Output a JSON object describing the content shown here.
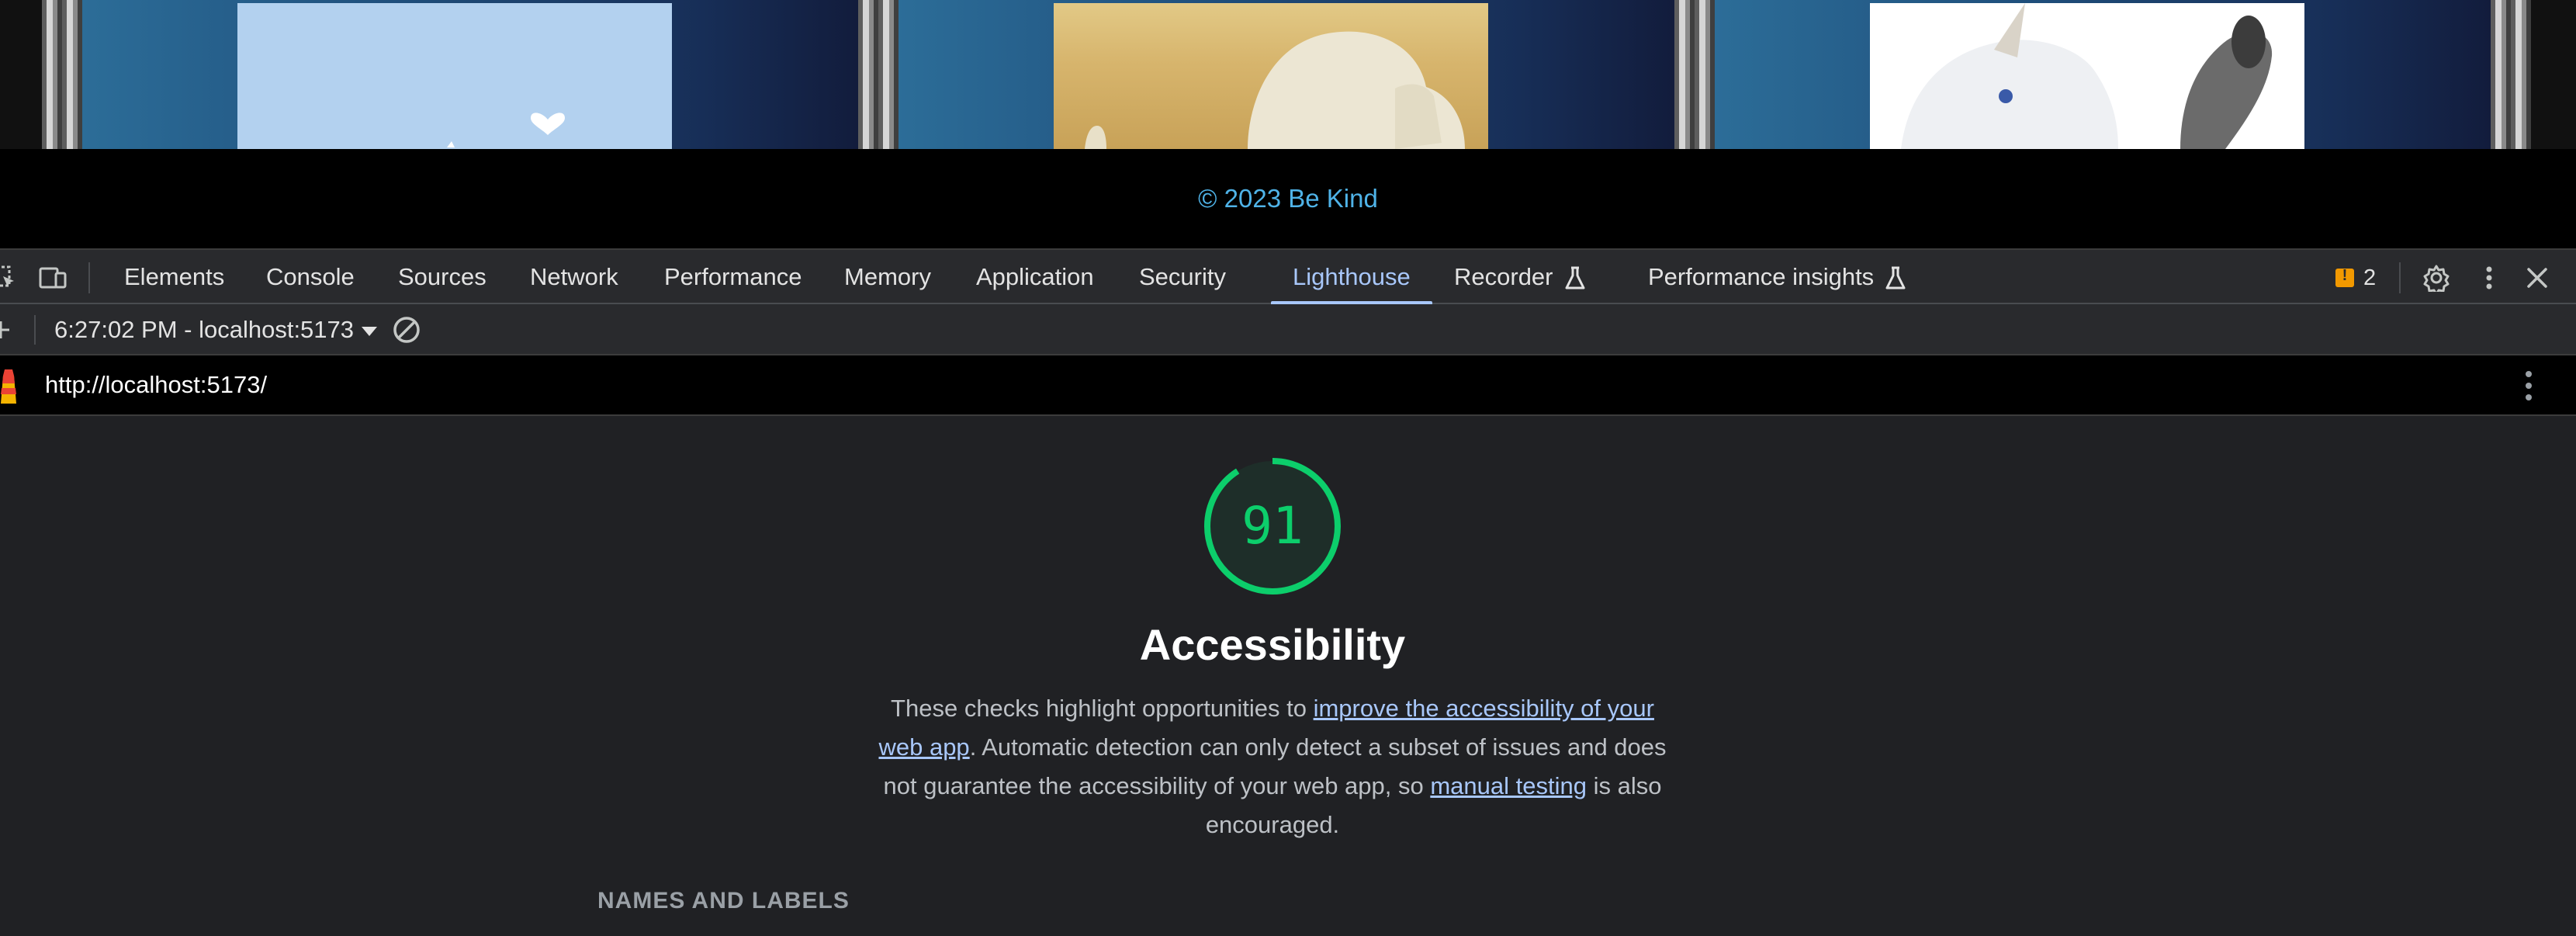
{
  "page": {
    "footer_text": "© 2023 Be Kind"
  },
  "devtools": {
    "tabs": [
      {
        "label": "Elements"
      },
      {
        "label": "Console"
      },
      {
        "label": "Sources"
      },
      {
        "label": "Network"
      },
      {
        "label": "Performance"
      },
      {
        "label": "Memory"
      },
      {
        "label": "Application"
      },
      {
        "label": "Security"
      },
      {
        "label": "Lighthouse",
        "active": true
      },
      {
        "label": "Recorder",
        "experimental": true
      },
      {
        "label": "Performance insights",
        "experimental": true
      }
    ],
    "issues_count": "2",
    "icons": [
      "inspect-element-icon",
      "device-toolbar-icon",
      "settings-gear-icon",
      "more-options-icon",
      "close-icon",
      "flask-icon",
      "issues-flag-icon"
    ]
  },
  "lighthouse": {
    "report_selector": "6:27:02 PM - localhost:5173",
    "url": "http://localhost:5173/",
    "score": "91",
    "score_fraction": 0.91,
    "category_title": "Accessibility",
    "description": {
      "part1": "These checks highlight opportunities to ",
      "link1": "improve the accessibility of your web app",
      "part2": ". Automatic detection can only detect a subset of issues and does not guarantee the accessibility of your web app, so ",
      "link2": "manual testing",
      "part3": " is also encouraged."
    },
    "group_heading": "NAMES AND LABELS"
  },
  "colors": {
    "score_pass": "#0cce6b",
    "tab_active": "#a8c7fa",
    "footer_link": "#4fb3e8",
    "issues_warning": "#f29900"
  }
}
